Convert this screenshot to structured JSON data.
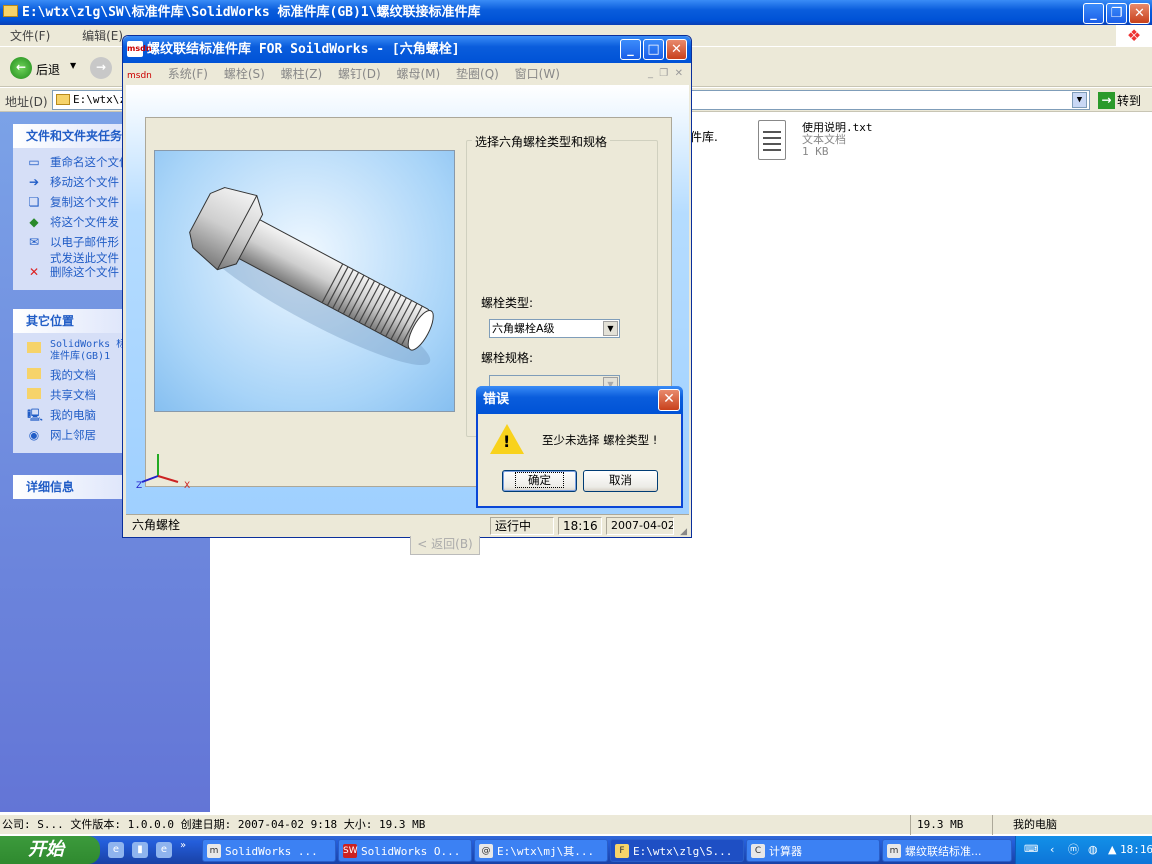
{
  "explorer": {
    "title": "E:\\wtx\\zlg\\SW\\标准件库\\SolidWorks 标准件库(GB)1\\螺纹联接标准件库",
    "menu": [
      "文件(F)",
      "编辑(E)"
    ],
    "back_label": "后退",
    "address_label": "地址(D)",
    "address_value": "E:\\wtx\\z",
    "goto_label": "转到",
    "tasks_header": "文件和文件夹任务",
    "tasks": [
      {
        "icon": "rename-icon",
        "label": "重命名这个文件"
      },
      {
        "icon": "move-icon",
        "label": "移动这个文件"
      },
      {
        "icon": "copy-icon",
        "label": "复制这个文件"
      },
      {
        "icon": "publish-icon",
        "label": "将这个文件发"
      },
      {
        "icon": "email-icon",
        "label": "以电子邮件形式发送此文件"
      },
      {
        "icon": "delete-icon",
        "label": "删除这个文件"
      }
    ],
    "places_header": "其它位置",
    "places": [
      {
        "icon": "folder-icon",
        "label": "SolidWorks 标准件库(GB)1"
      },
      {
        "icon": "documents-icon",
        "label": "我的文档"
      },
      {
        "icon": "shared-folder-icon",
        "label": "共享文档"
      },
      {
        "icon": "computer-icon",
        "label": "我的电脑"
      },
      {
        "icon": "network-icon",
        "label": "网上邻居"
      }
    ],
    "details_header": "详细信息",
    "partial_file_label": "件库.",
    "file": {
      "name": "使用说明.txt",
      "type": "文本文档",
      "size": "1 KB"
    },
    "status_left": "公司: S... 文件版本: 1.0.0.0 创建日期: 2007-04-02 9:18 大小: 19.3 MB",
    "status_size": "19.3 MB",
    "status_location": "我的电脑"
  },
  "app": {
    "title": "螺纹联结标准件库 FOR SoildWorks - [六角螺栓]",
    "menu": [
      "系统(F)",
      "螺栓(S)",
      "螺柱(Z)",
      "螺钉(D)",
      "螺母(M)",
      "垫圈(Q)",
      "窗口(W)"
    ],
    "group_title": "选择六角螺栓类型和规格",
    "bolt_type_label": "螺栓类型:",
    "bolt_type_value": "六角螺栓A级",
    "bolt_spec_label": "螺栓规格:",
    "bolt_spec_value": "",
    "back_button": "< 返回(B)",
    "status": [
      "六角螺栓",
      "运行中",
      "18:16",
      "2007-04-02"
    ],
    "axis_labels": {
      "z": "Z",
      "x": "X"
    }
  },
  "dialog": {
    "title": "错误",
    "message": "至少未选择 螺栓类型 !",
    "ok": "确定",
    "cancel": "取消"
  },
  "taskbar": {
    "start": "开始",
    "tasks": [
      {
        "icon": "m",
        "label": "SolidWorks ..."
      },
      {
        "icon": "SW",
        "label": "SolidWorks O..."
      },
      {
        "icon": "@",
        "label": "E:\\wtx\\mj\\其..."
      },
      {
        "icon": "F",
        "label": "E:\\wtx\\zlg\\S..."
      },
      {
        "icon": "C",
        "label": "计算器"
      },
      {
        "icon": "m",
        "label": "螺纹联结标准..."
      }
    ],
    "clock": "18:16"
  },
  "colors": {
    "xp_blue": "#0a5ddc",
    "task_panel": "#d6dff7",
    "warning": "#f8d21c"
  }
}
